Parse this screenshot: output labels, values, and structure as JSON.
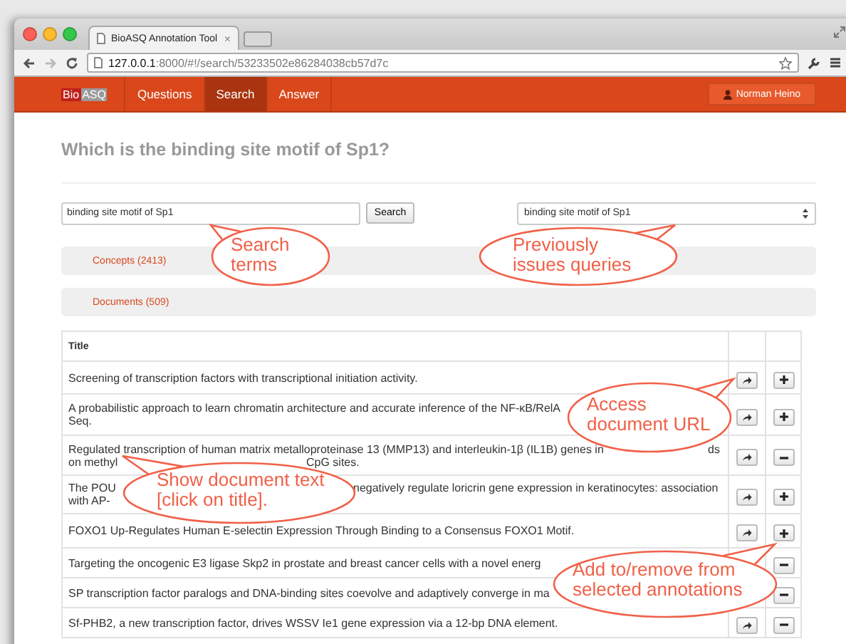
{
  "browser": {
    "tab_title": "BioASQ Annotation Tool",
    "tab_close": "×",
    "url_host": "127.0.0.1",
    "url_rest": ":8000/#!/search/53233502e86284038cb57d7c",
    "forward_disabled": true
  },
  "navbar": {
    "logo_left": "Bio",
    "logo_right": "ASQ",
    "items": [
      {
        "label": "Questions",
        "selected": false
      },
      {
        "label": "Search",
        "selected": true
      },
      {
        "label": "Answer",
        "selected": false
      }
    ],
    "user": "Norman Heino"
  },
  "question": "Which is the binding site motif of Sp1?",
  "search": {
    "value": "binding site motif of Sp1",
    "button": "Search",
    "history_value": "binding site motif of Sp1"
  },
  "sections": [
    "Concepts (2413)",
    "Documents (509)"
  ],
  "table": {
    "columns": [
      "Title"
    ],
    "rows": [
      {
        "lines": [
          [
            "Screening of transcription factors with transcriptional initiation activity."
          ]
        ],
        "in_selection": false
      },
      {
        "lines": [
          [
            "A probabilistic approach to learn chromatin architecture and accurate inference of the NF-κB/RelA"
          ],
          [
            "Seq."
          ]
        ],
        "in_selection": false
      },
      {
        "lines": [
          [
            "Regulated transcription of human matrix metalloproteinase 13 (MMP13) and interleukin-1β (IL1B) genes in",
            "ds"
          ],
          [
            "on methyl",
            "CpG sites."
          ]
        ],
        "in_selection": true
      },
      {
        "lines": [
          [
            "The POU",
            "negatively regulate loricrin gene expression in keratinocytes: association"
          ],
          [
            "with AP-"
          ]
        ],
        "in_selection": false
      },
      {
        "lines": [
          [
            "FOXO1 Up-Regulates Human E-selectin Expression Through Binding to a Consensus FOXO1 Motif."
          ]
        ],
        "in_selection": false
      },
      {
        "lines": [
          [
            "Targeting the oncogenic E3 ligase Skp2 in prostate and breast cancer cells with a novel energ"
          ]
        ],
        "in_selection": true
      },
      {
        "lines": [
          [
            "SP transcription factor paralogs and DNA-binding sites coevolve and adaptively converge in ma"
          ]
        ],
        "in_selection": true
      },
      {
        "lines": [
          [
            "Sf-PHB2, a new transcription factor, drives WSSV Ie1 gene expression via a 12-bp DNA element."
          ]
        ],
        "in_selection": true
      }
    ]
  },
  "callouts": [
    {
      "text": "Search terms"
    },
    {
      "text": "Previously issues queries"
    },
    {
      "text": "Access document URL"
    },
    {
      "text": "Show document text [click on title]."
    },
    {
      "text": "Add to/remove from selected annotations"
    }
  ]
}
